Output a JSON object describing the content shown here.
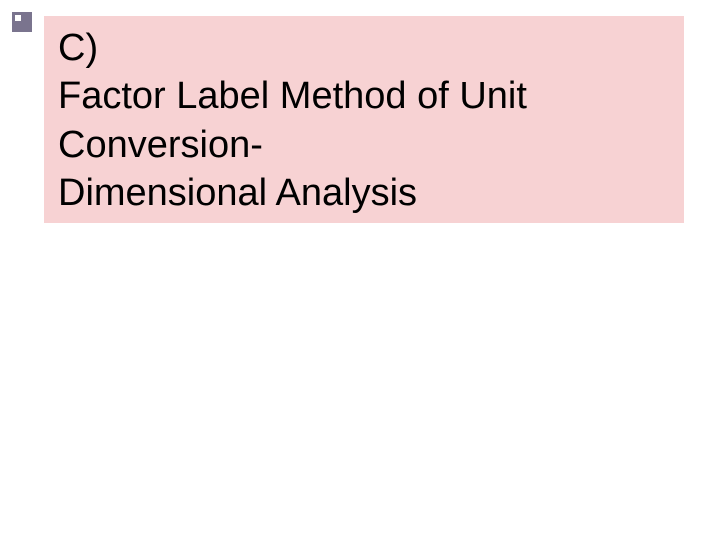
{
  "slide": {
    "heading_label": "C)",
    "title_line1": "Factor Label Method of Unit",
    "title_line2": "Conversion-",
    "title_line3": "Dimensional Analysis"
  }
}
